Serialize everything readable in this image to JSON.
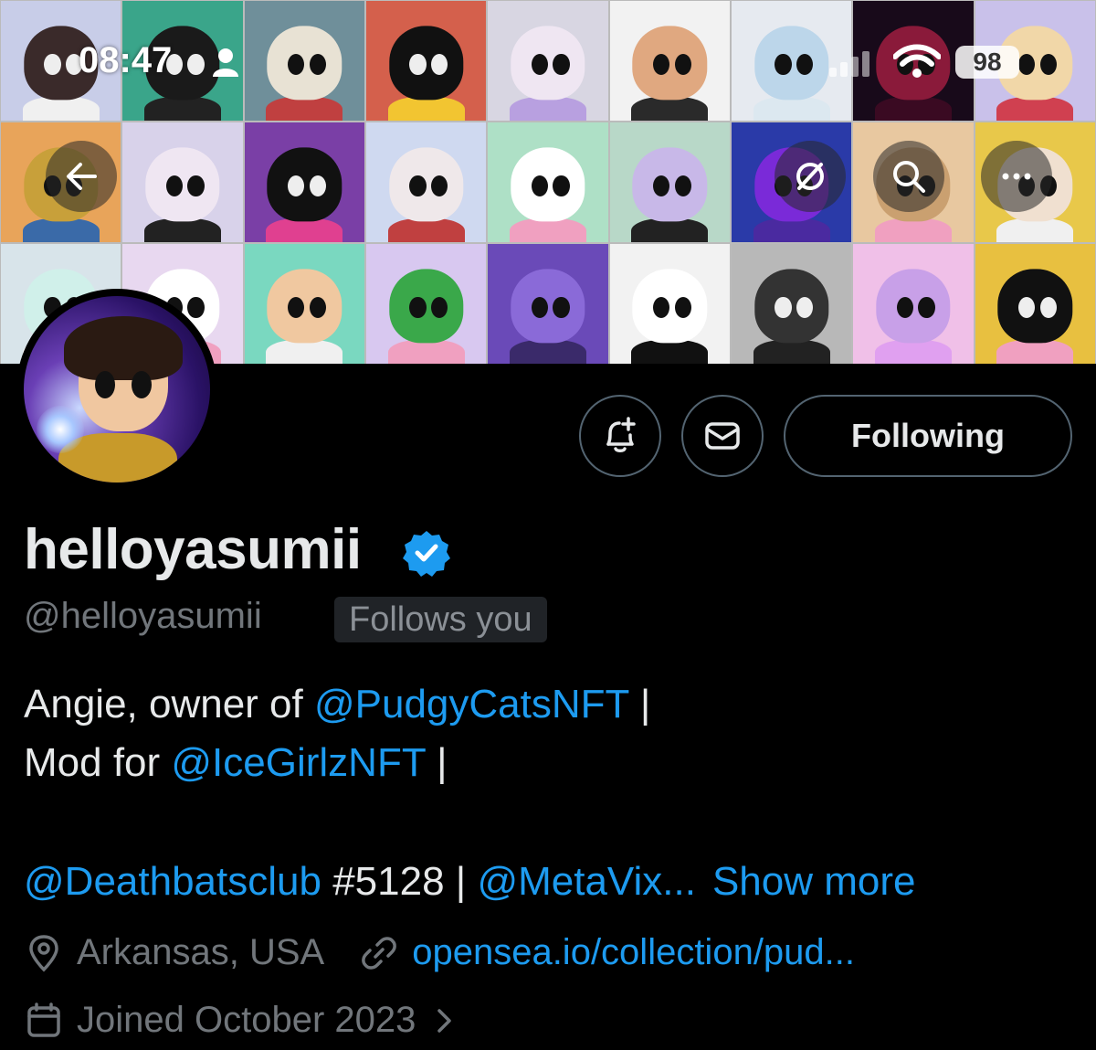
{
  "status_bar": {
    "time": "08:47",
    "battery": "98"
  },
  "banner": {
    "tiles": [
      {
        "bg": "#c8cde8",
        "skin": "#3a2a2a",
        "body": "#f0f0f0"
      },
      {
        "bg": "#3aa58a",
        "skin": "#1a1a1a",
        "body": "#222"
      },
      {
        "bg": "#6f8f9a",
        "skin": "#e8e2d4",
        "body": "#c04040"
      },
      {
        "bg": "#d4604c",
        "skin": "#111",
        "body": "#f2c531"
      },
      {
        "bg": "#d8d6e2",
        "skin": "#efe6f2",
        "body": "#b8a0e0"
      },
      {
        "bg": "#f2f2f2",
        "skin": "#e0a880",
        "body": "#2a2a2a"
      },
      {
        "bg": "#e6eaf0",
        "skin": "#bcd6ea",
        "body": "#dce8f0"
      },
      {
        "bg": "#180a1a",
        "skin": "#8a1a3a",
        "body": "#3a0a22"
      },
      {
        "bg": "#c9c1ea",
        "skin": "#f1d7a8",
        "body": "#d04050"
      },
      {
        "bg": "#e8a45a",
        "skin": "#c8a03a",
        "body": "#3a6aa8"
      },
      {
        "bg": "#d8d2ea",
        "skin": "#efe6f2",
        "body": "#222"
      },
      {
        "bg": "#7a3fa6",
        "skin": "#111",
        "body": "#e04090"
      },
      {
        "bg": "#cfd9f0",
        "skin": "#efe8ea",
        "body": "#c04040"
      },
      {
        "bg": "#aee0c6",
        "skin": "#ffffff",
        "body": "#f0a0c0"
      },
      {
        "bg": "#b8d8c8",
        "skin": "#c8b8e8",
        "body": "#222"
      },
      {
        "bg": "#2a3aa8",
        "skin": "#7a2ad8",
        "body": "#4a2aa0"
      },
      {
        "bg": "#e8c8a0",
        "skin": "#caa070",
        "body": "#f0a0c0"
      },
      {
        "bg": "#e8c84a",
        "skin": "#f0e0d0",
        "body": "#f0f0f0"
      },
      {
        "bg": "#d8e4ea",
        "skin": "#d0f0ea",
        "body": "#fff"
      },
      {
        "bg": "#e8d8f0",
        "skin": "#ffffff",
        "body": "#f0a0c0"
      },
      {
        "bg": "#7ad8c0",
        "skin": "#f0c8a0",
        "body": "#f0f0f0"
      },
      {
        "bg": "#d8c8f0",
        "skin": "#3aa84a",
        "body": "#f0a0c0"
      },
      {
        "bg": "#6a4ab8",
        "skin": "#8a6ad8",
        "body": "#3a2a6a"
      },
      {
        "bg": "#f2f2f2",
        "skin": "#ffffff",
        "body": "#111"
      },
      {
        "bg": "#b8b8b8",
        "skin": "#333",
        "body": "#222"
      },
      {
        "bg": "#f0c0e8",
        "skin": "#c8a0e8",
        "body": "#e0a0f0"
      },
      {
        "bg": "#e8c040",
        "skin": "#111",
        "body": "#f0a0c0"
      }
    ]
  },
  "header_buttons": {
    "back": "back-arrow-icon",
    "hide": "eye-slash-icon",
    "search": "search-icon",
    "more": "more-icon"
  },
  "actions": {
    "notify": "bell-plus-icon",
    "message": "envelope-icon",
    "following_label": "Following"
  },
  "profile": {
    "display_name": "helloyasumii",
    "handle": "@helloyasumii",
    "follows_you": "Follows you",
    "bio": {
      "line1_text": "Angie, owner of ",
      "line1_link": "@PudgyCatsNFT",
      "line1_tail": " |",
      "line2_text": "Mod for ",
      "line2_link": "@IceGirlzNFT",
      "line2_tail": " |",
      "line3_link1": "@Deathbatsclub",
      "line3_text": " #5128 | ",
      "line3_link2": "@MetaVix...",
      "show_more": "Show more"
    },
    "location": "Arkansas, USA",
    "website": "opensea.io/collection/pud...",
    "joined": "Joined October 2023"
  },
  "colors": {
    "accent": "#1d9bf0",
    "muted": "#71767b",
    "background": "#000000",
    "border": "#536471"
  }
}
